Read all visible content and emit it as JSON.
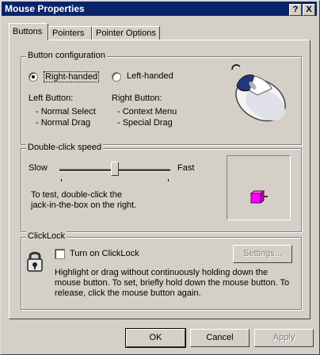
{
  "window": {
    "title": "Mouse Properties",
    "help_glyph": "?",
    "close_glyph": "X"
  },
  "tabs": [
    {
      "label": "Buttons",
      "active": true
    },
    {
      "label": "Pointers",
      "active": false
    },
    {
      "label": "Pointer Options",
      "active": false
    }
  ],
  "button_config": {
    "group_label": "Button configuration",
    "right_handed_label": "Right-handed",
    "left_handed_label": "Left-handed",
    "selected": "right",
    "left_button_heading": "Left Button:",
    "left_button_items": [
      "-  Normal Select",
      "-  Normal Drag"
    ],
    "right_button_heading": "Right Button:",
    "right_button_items": [
      "-  Context Menu",
      "-  Special Drag"
    ]
  },
  "double_click": {
    "group_label": "Double-click speed",
    "slow_label": "Slow",
    "fast_label": "Fast",
    "slider_fraction": 0.5,
    "instructions": "To test, double-click the jack-in-the-box on the right."
  },
  "clicklock": {
    "group_label": "ClickLock",
    "checkbox_label": "Turn on ClickLock",
    "checked": false,
    "settings_label": "Settings...",
    "description": "Highlight or drag without continuously holding down the mouse button. To set, briefly hold down the mouse button. To release, click the mouse button again."
  },
  "footer": {
    "ok_label": "OK",
    "cancel_label": "Cancel",
    "apply_label": "Apply"
  }
}
